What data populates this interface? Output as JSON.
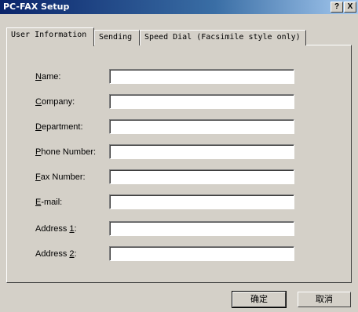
{
  "window": {
    "title": "PC-FAX Setup",
    "help_label": "?",
    "close_label": "X"
  },
  "tabs": [
    {
      "label": "User Information",
      "active": true
    },
    {
      "label": "Sending",
      "active": false
    },
    {
      "label": "Speed Dial (Facsimile style only)",
      "active": false
    }
  ],
  "fields": [
    {
      "mnemonic": "N",
      "rest": "ame:",
      "value": ""
    },
    {
      "mnemonic": "C",
      "rest": "ompany:",
      "value": ""
    },
    {
      "mnemonic": "D",
      "rest": "epartment:",
      "value": ""
    },
    {
      "mnemonic": "P",
      "rest": "hone Number:",
      "value": ""
    },
    {
      "mnemonic": "F",
      "rest": "ax Number:",
      "value": ""
    },
    {
      "mnemonic": "E",
      "rest": "-mail:",
      "value": ""
    },
    {
      "prefix": "Address ",
      "mnemonic": "1",
      "rest": ":",
      "value": ""
    },
    {
      "prefix": "Address ",
      "mnemonic": "2",
      "rest": ":",
      "value": ""
    }
  ],
  "buttons": {
    "ok_label": "确定",
    "cancel_label": "取消"
  }
}
